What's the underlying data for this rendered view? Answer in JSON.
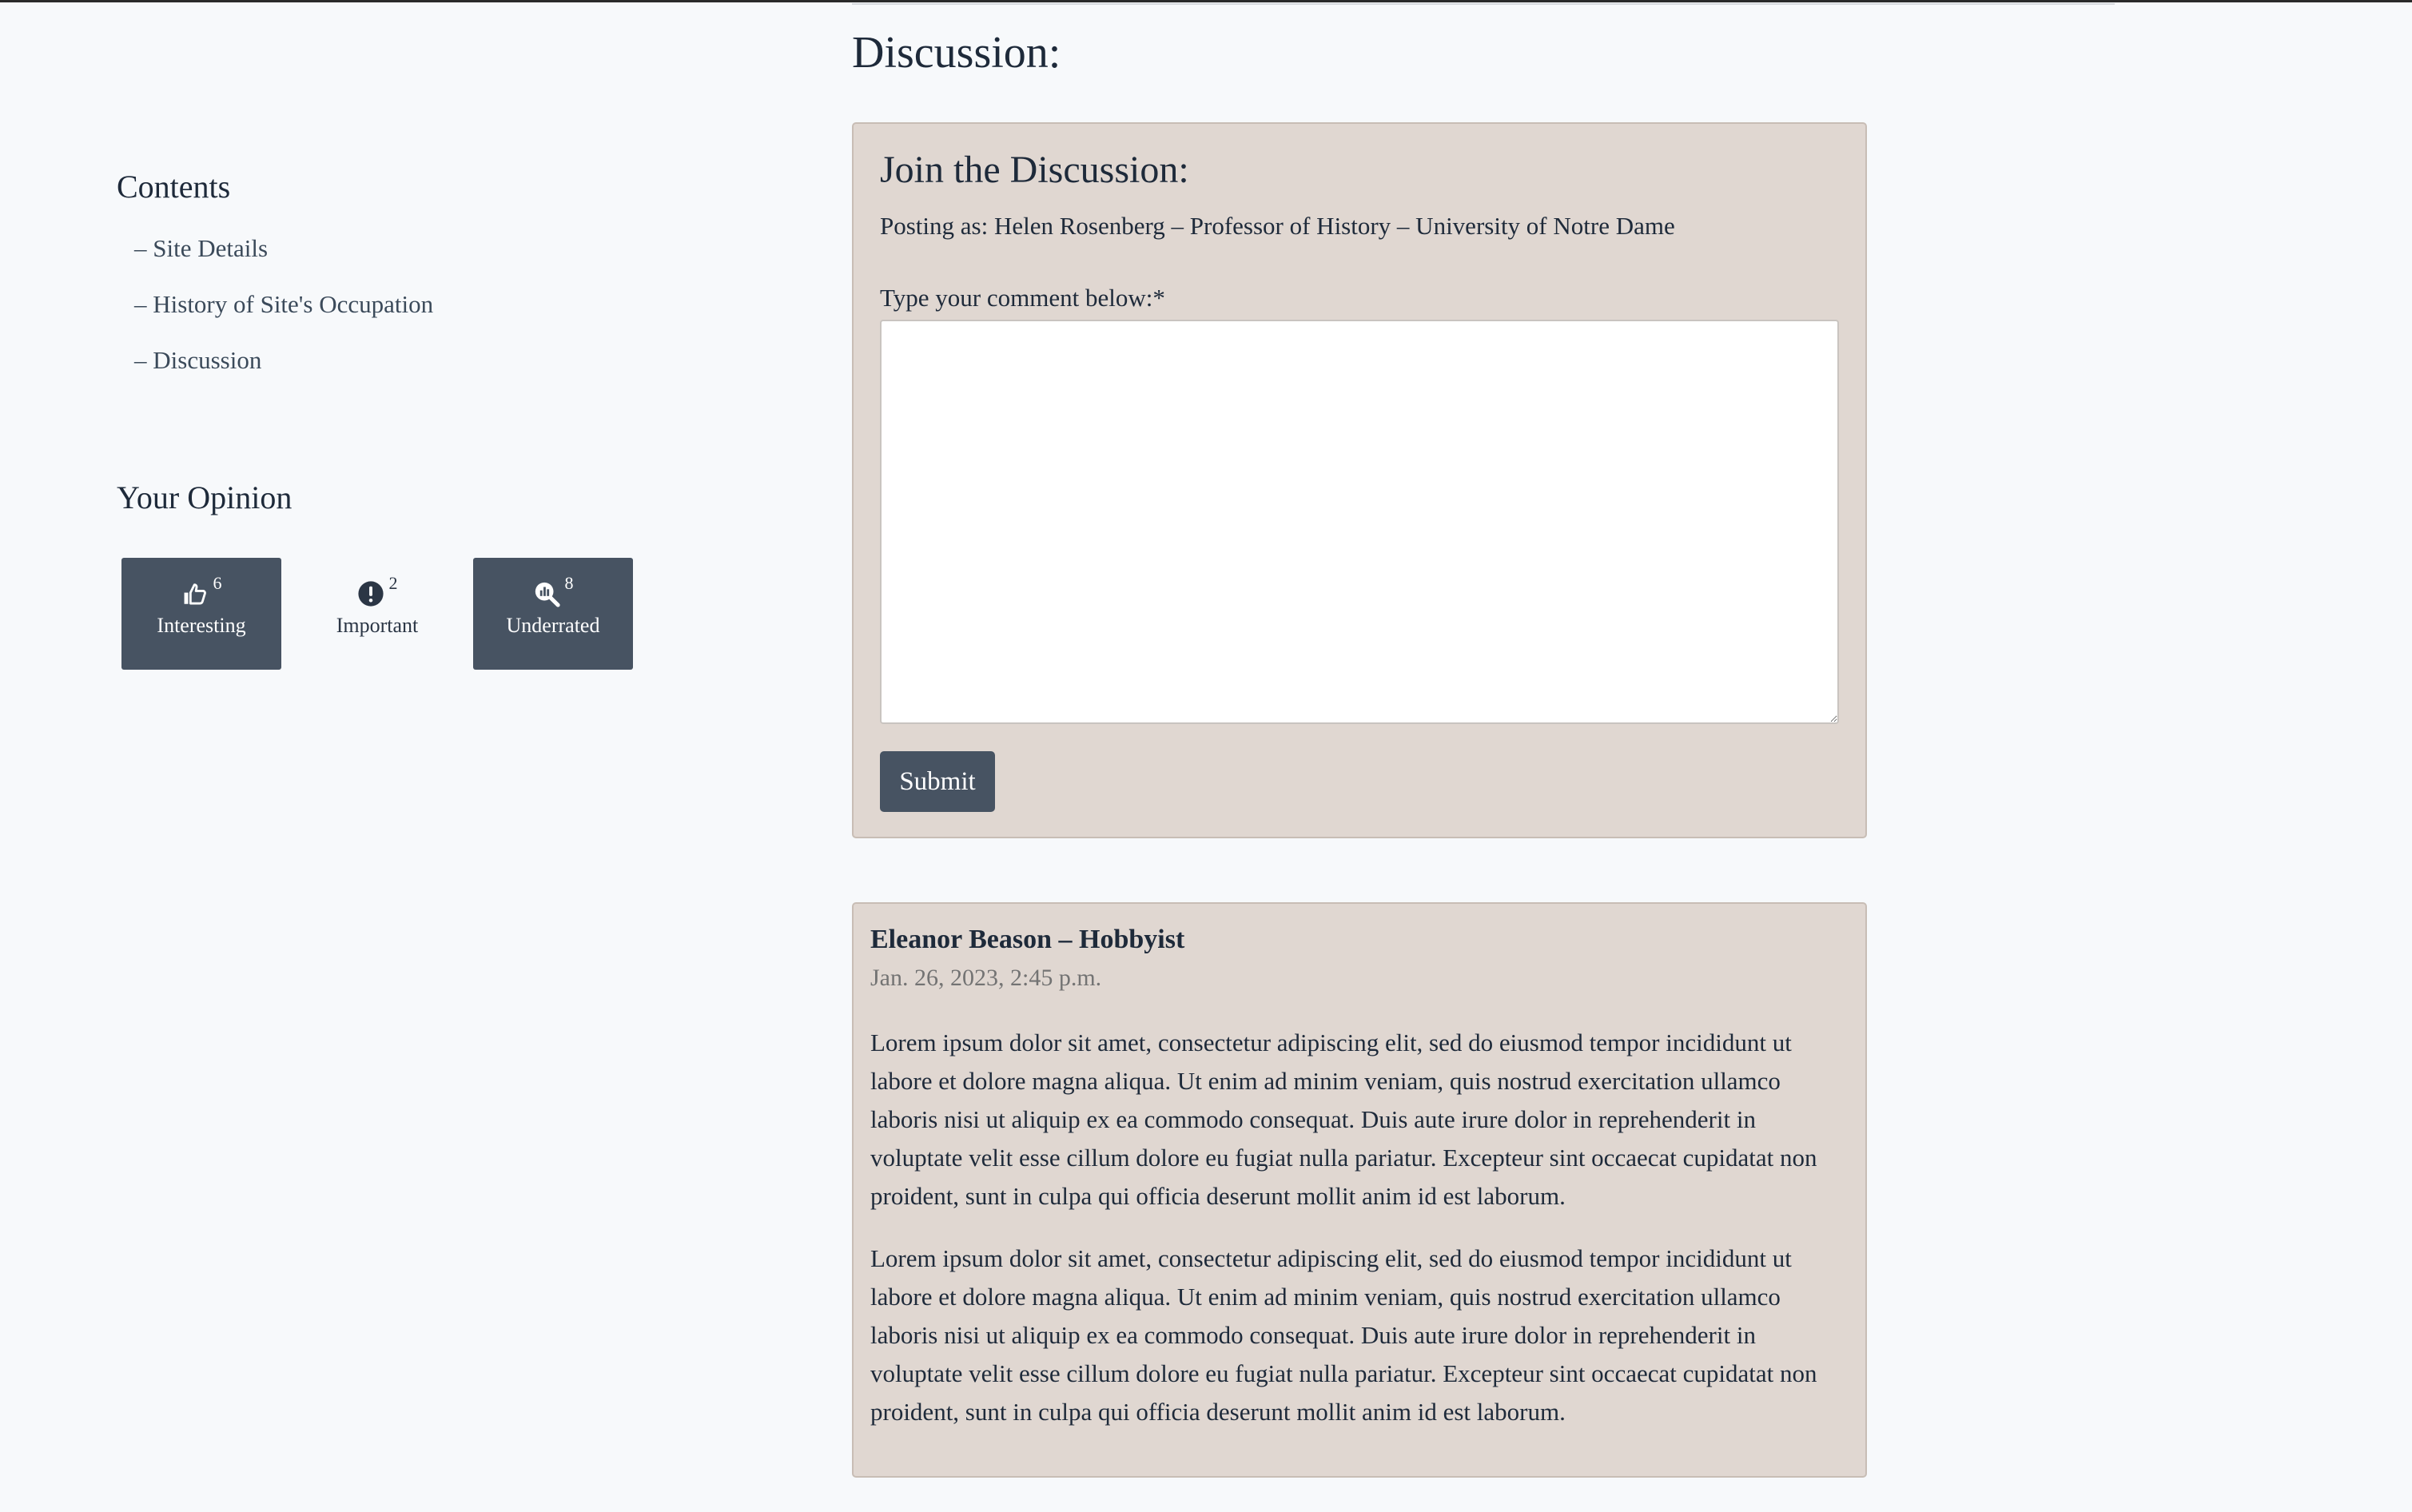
{
  "sidebar": {
    "contents_title": "Contents",
    "toc": [
      {
        "label": "– Site Details"
      },
      {
        "label": "– History of Site's Occupation"
      },
      {
        "label": "– Discussion"
      }
    ],
    "opinion_title": "Your Opinion",
    "opinions": [
      {
        "label": "Interesting",
        "count": "6",
        "icon": "thumbs-up-icon",
        "selected": true
      },
      {
        "label": "Important",
        "count": "2",
        "icon": "exclamation-circle-icon",
        "selected": false
      },
      {
        "label": "Underrated",
        "count": "8",
        "icon": "magnifier-chart-icon",
        "selected": true
      }
    ]
  },
  "main": {
    "heading": "Discussion:",
    "join": {
      "title": "Join the Discussion:",
      "posting_as": "Posting as: Helen Rosenberg – Professor of History – University of Notre Dame",
      "comment_label": "Type your comment below:*",
      "comment_value": "",
      "submit_label": "Submit"
    },
    "comments": [
      {
        "author": "Eleanor Beason – Hobbyist",
        "date": "Jan. 26, 2023, 2:45 p.m.",
        "paragraphs": [
          "Lorem ipsum dolor sit amet, consectetur adipiscing elit, sed do eiusmod tempor incididunt ut labore et dolore magna aliqua. Ut enim ad minim veniam, quis nostrud exercitation ullamco laboris nisi ut aliquip ex ea commodo consequat. Duis aute irure dolor in reprehenderit in voluptate velit esse cillum dolore eu fugiat nulla pariatur. Excepteur sint occaecat cupidatat non proident, sunt in culpa qui officia deserunt mollit anim id est laborum.",
          "Lorem ipsum dolor sit amet, consectetur adipiscing elit, sed do eiusmod tempor incididunt ut labore et dolore magna aliqua. Ut enim ad minim veniam, quis nostrud exercitation ullamco laboris nisi ut aliquip ex ea commodo consequat. Duis aute irure dolor in reprehenderit in voluptate velit esse cillum dolore eu fugiat nulla pariatur. Excepteur sint occaecat cupidatat non proident, sunt in culpa qui officia deserunt mollit anim id est laborum."
        ]
      }
    ]
  },
  "colors": {
    "page_bg": "#f7f9fb",
    "panel_bg": "#e0d7d1",
    "button_bg": "#475362",
    "text": "#1e2a3a",
    "muted_text": "#737373"
  }
}
